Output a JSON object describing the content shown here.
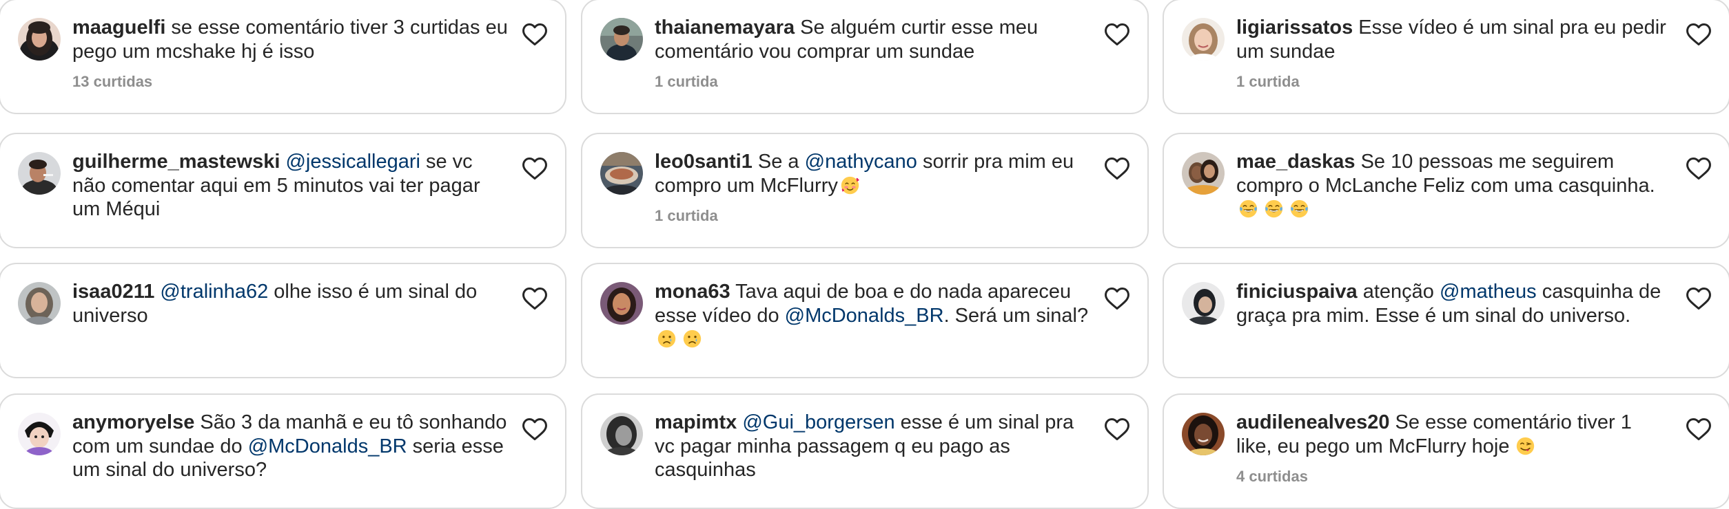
{
  "comments": [
    {
      "id": "c1",
      "username": "maaguelfi",
      "text": " se esse comentário tiver 3 curtidas eu pego um mcshake hj é isso",
      "likes": "13 curtidas"
    },
    {
      "id": "c2",
      "username": "thaianemayara",
      "text": " Se alguém curtir esse meu comentário vou comprar um sundae",
      "likes": "1 curtida"
    },
    {
      "id": "c3",
      "username": "ligiarissatos",
      "text": " Esse vídeo é um sinal pra eu pedir um sundae",
      "likes": "1 curtida"
    },
    {
      "id": "c4",
      "username": "guilherme_mastewski",
      "mention": "@jessicallegari",
      "text": " se vc não comentar aqui em 5 minutos vai ter pagar um Méqui"
    },
    {
      "id": "c5",
      "username": "leo0santi1",
      "text_before": " Se a ",
      "mention": "@nathycano",
      "text": " sorrir pra mim eu compro um McFlurry",
      "emoji": "smiling-face-with-hearts",
      "likes": "1 curtida"
    },
    {
      "id": "c6",
      "username": "mae_daskas",
      "text": " Se 10 pessoas me seguirem compro o McLanche Feliz com uma casquinha.",
      "emoji": "face-with-tears-of-joy",
      "emoji_count": 3
    },
    {
      "id": "c7",
      "username": "isaa0211",
      "mention": "@tralinha62",
      "text": " olhe isso é um sinal do universo"
    },
    {
      "id": "c8",
      "username": "mona63",
      "text_before": " Tava aqui de boa e do nada apareceu esse vídeo do ",
      "mention": "@McDonalds_BR",
      "text": ". Será um sinal?",
      "emoji": "crying-face",
      "emoji_count": 2
    },
    {
      "id": "c9",
      "username": "finiciuspaiva",
      "text_before": " atenção ",
      "mention": "@matheus",
      "text": " casquinha de graça pra mim. Esse é um sinal do universo."
    },
    {
      "id": "c10",
      "username": "anymoryelse",
      "text_before": " São 3 da manhã e eu tô sonhando com um sundae do ",
      "mention": "@McDonalds_BR",
      "text": " seria esse um sinal do universo?"
    },
    {
      "id": "c11",
      "username": "mapimtx",
      "mention": "@Gui_borgersen",
      "text": " esse é um sinal pra vc pagar minha passagem q eu pago as casquinhas"
    },
    {
      "id": "c12",
      "username": "audilenealves20",
      "text": " Se esse comentário tiver 1 like, eu pego um McFlurry hoje",
      "emoji": "face-savoring-food",
      "likes": "4 curtidas"
    }
  ],
  "colors": {
    "text": "#262626",
    "mention": "#00376b",
    "muted": "#8e8e8e",
    "border": "#dbdbdb"
  },
  "icons": {
    "like": "heart-outline-icon"
  }
}
